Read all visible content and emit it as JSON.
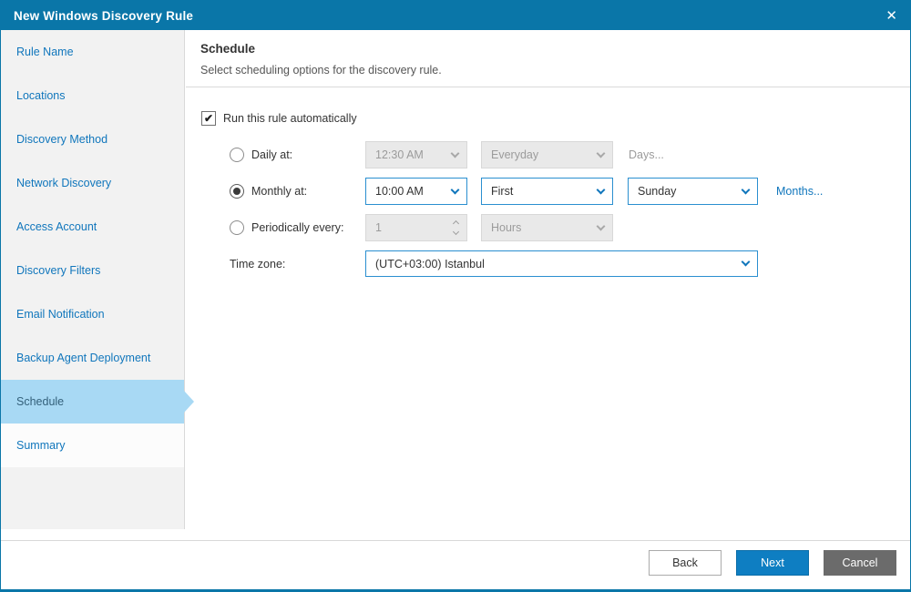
{
  "window": {
    "title": "New Windows Discovery Rule"
  },
  "glyphs": {
    "close": "✕",
    "check": "✔"
  },
  "colors": {
    "titlebar": "#0a76a8",
    "accent_link": "#1076bc",
    "selected_step_highlight": "#a8d9f4",
    "primary_button": "#0e7ec2",
    "enabled_combo_border": "#2a8fd0"
  },
  "sidebar": {
    "items": [
      {
        "label": "Rule Name",
        "active": false
      },
      {
        "label": "Locations",
        "active": false
      },
      {
        "label": "Discovery Method",
        "active": false
      },
      {
        "label": "Network Discovery",
        "active": false
      },
      {
        "label": "Access Account",
        "active": false
      },
      {
        "label": "Discovery Filters",
        "active": false
      },
      {
        "label": "Email Notification",
        "active": false
      },
      {
        "label": "Backup Agent Deployment",
        "active": false
      },
      {
        "label": "Schedule",
        "active": true
      },
      {
        "label": "Summary",
        "active": false
      }
    ]
  },
  "schedule": {
    "title": "Schedule",
    "subtitle": "Select scheduling options for the discovery rule.",
    "run_automatically": {
      "label": "Run this rule automatically",
      "checked": true
    },
    "daily": {
      "label": "Daily at:",
      "selected": false,
      "enabled": false,
      "time": "12:30 AM",
      "frequency": "Everyday",
      "days_link": "Days..."
    },
    "monthly": {
      "label": "Monthly at:",
      "selected": true,
      "enabled": true,
      "time": "10:00 AM",
      "ordinal": "First",
      "weekday": "Sunday",
      "months_link": "Months..."
    },
    "periodically": {
      "label": "Periodically every:",
      "selected": false,
      "enabled": false,
      "value": "1",
      "unit": "Hours"
    },
    "timezone": {
      "label": "Time zone:",
      "value": "(UTC+03:00) Istanbul"
    }
  },
  "footer": {
    "back": "Back",
    "next": "Next",
    "cancel": "Cancel"
  }
}
